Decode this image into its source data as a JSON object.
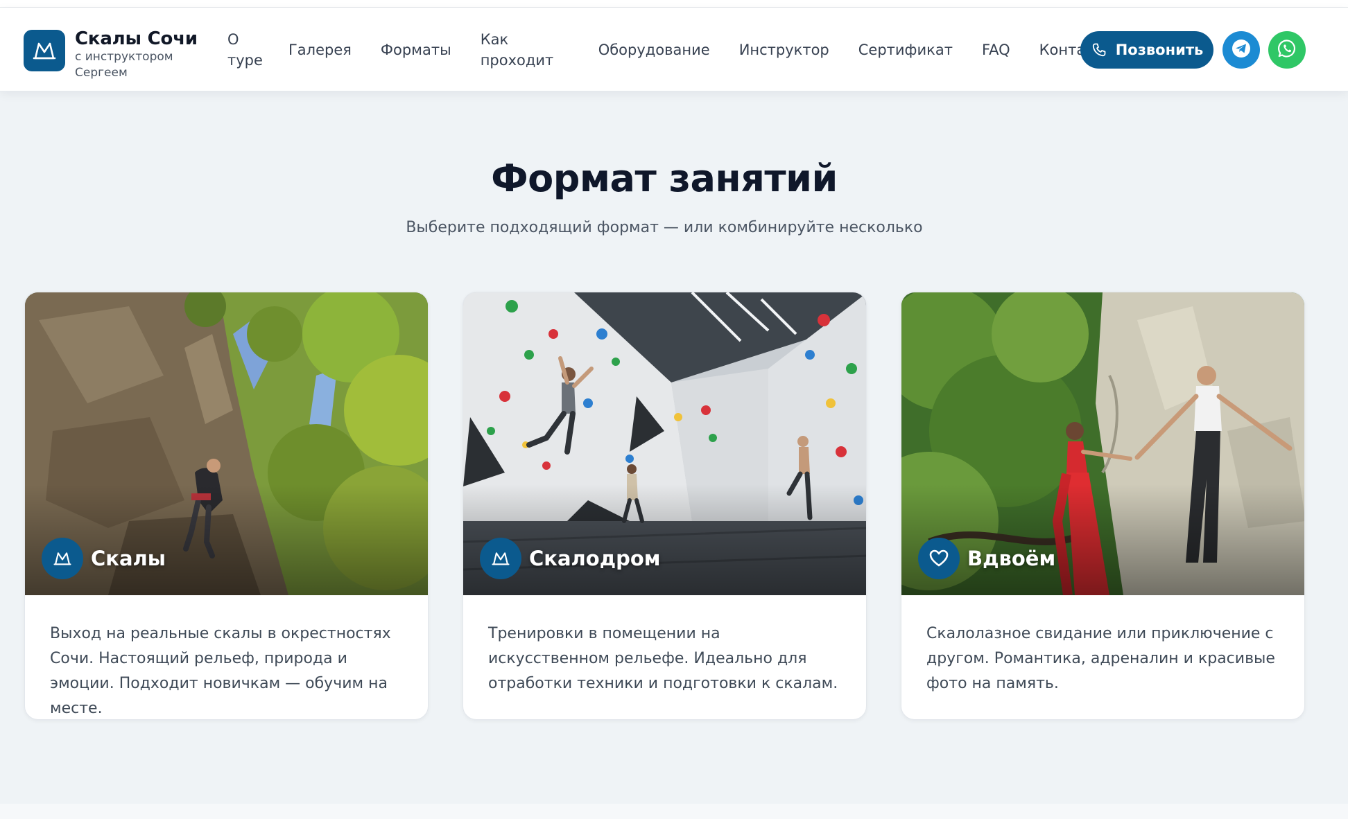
{
  "header": {
    "brand_title": "Скалы Сочи",
    "brand_subtitle": "с инструктором Сергеем",
    "brand_icon": "mountain-icon",
    "nav": [
      {
        "label": "О туре"
      },
      {
        "label": "Галерея"
      },
      {
        "label": "Форматы"
      },
      {
        "label": "Как проходит"
      },
      {
        "label": "Оборудование"
      },
      {
        "label": "Инструктор"
      },
      {
        "label": "Сертификат"
      },
      {
        "label": "FAQ"
      },
      {
        "label": "Контакты"
      }
    ],
    "call_label": "Позвонить",
    "call_icon": "phone-icon",
    "telegram_icon": "telegram-icon",
    "whatsapp_icon": "whatsapp-icon"
  },
  "section": {
    "title": "Формат занятий",
    "subtitle": "Выберите подходящий формат — или комбинируйте несколько"
  },
  "cards": [
    {
      "title": "Скалы",
      "icon": "mountain-icon",
      "description": "Выход на реальные скалы в окрестностях Сочи. Настоящий рельеф, природа и эмоции. Подходит новичкам — обучим на месте."
    },
    {
      "title": "Скалодром",
      "icon": "mountain-icon",
      "description": "Тренировки в помещении на искусственном рельефе. Идеально для отработки техники и подготовки к скалам."
    },
    {
      "title": "Вдвоём",
      "icon": "heart-icon",
      "description": "Скалолазное свидание или приключение с другом. Романтика, адреналин и красивые фото на память."
    }
  ],
  "colors": {
    "brand": "#0b5a8e",
    "telegram": "#1c8bd3",
    "whatsapp": "#2fc766",
    "background": "#eff3f6"
  }
}
